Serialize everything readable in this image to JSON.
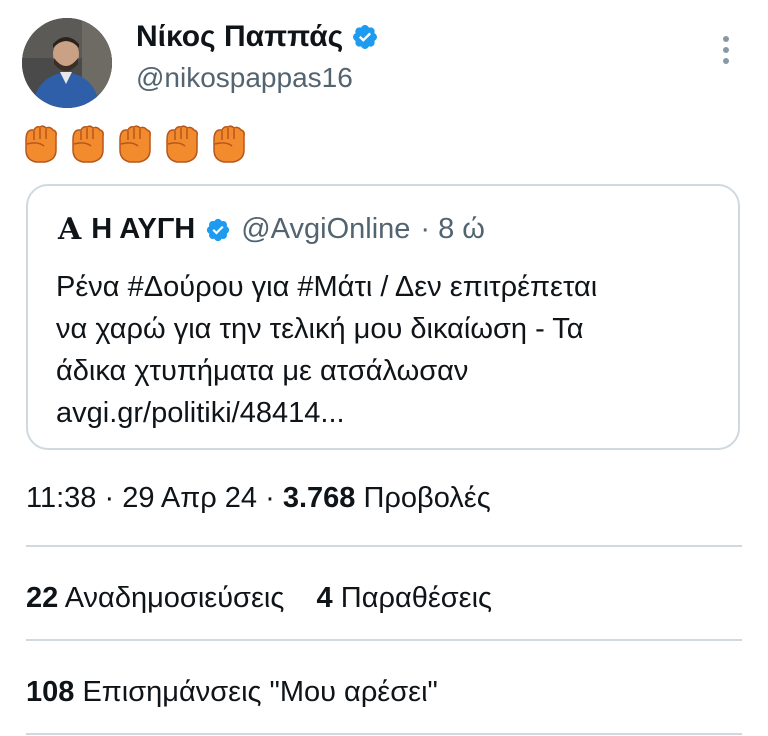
{
  "author": {
    "name": "Νίκος Παππάς",
    "handle": "@nikospappas16"
  },
  "emoji_text": "✊✊✊✊✊",
  "quoted_tweet": {
    "logo": "Α",
    "name": "Η ΑΥΓΗ",
    "handle": "@AvgiOnline",
    "time": "· 8 ώ",
    "lines": [
      "Ρένα #Δούρου για #Μάτι / Δεν επιτρέπεται",
      "να χαρώ για την τελική μου δικαίωση - Τα",
      "άδικα χτυπήματα με ατσάλωσαν",
      "avgi.gr/politiki/48414..."
    ]
  },
  "meta": {
    "datetime": "11:38 · 29 Απρ 24 · ",
    "views_count": "3.768",
    "views_label": " Προβολές"
  },
  "stats": {
    "reposts_count": "22",
    "reposts_label": "Αναδημοσιεύσεις",
    "quotes_count": "4",
    "quotes_label": "Παραθέσεις",
    "likes_count": "108",
    "likes_label": "Επισημάνσεις \"Μου αρέσει\""
  },
  "colors": {
    "verified_blue": "#1d9bf0",
    "text_primary": "#0f1419",
    "text_secondary": "#536471",
    "border": "#cfd9de",
    "emoji_orange": "#f28a2e"
  }
}
